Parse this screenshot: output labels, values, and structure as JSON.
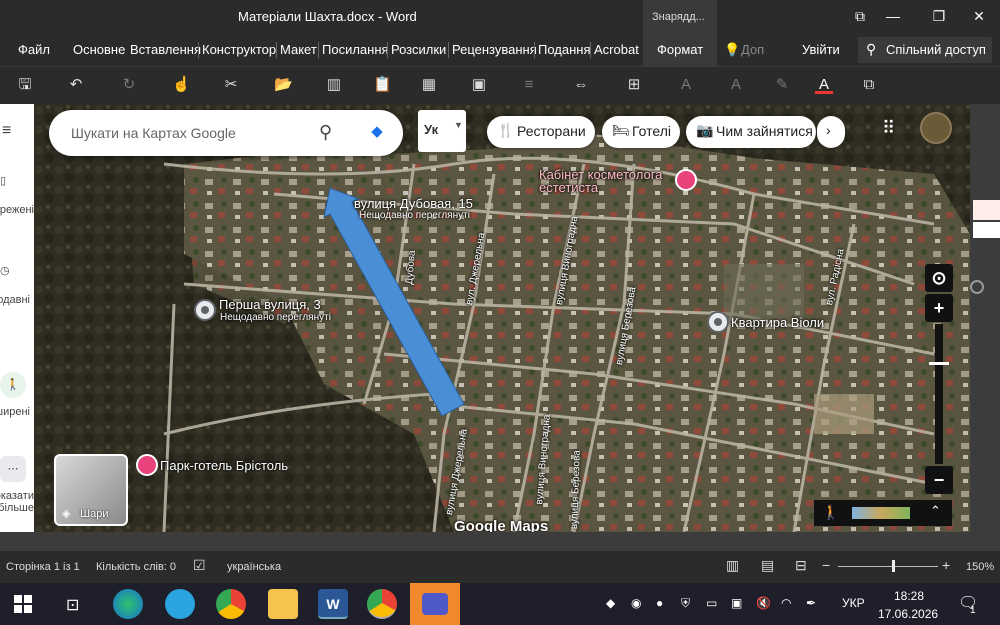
{
  "window": {
    "title": "Матеріали Шахта.docx - Word",
    "tools_tab": "Знарядд...",
    "controls": [
      "minimize",
      "restore",
      "close"
    ]
  },
  "ribbon": {
    "tabs": [
      "Файл",
      "Основне",
      "Вставлення",
      "Конструктор",
      "Макет",
      "Посилання",
      "Розсилки",
      "Рецензування",
      "Подання",
      "Acrobat",
      "Формат"
    ],
    "tell_me": "Доп",
    "sign_in": "Увійти",
    "share": "Спільний доступ"
  },
  "map": {
    "search_placeholder": "Шукати на Картах Google",
    "lang_button": "Ук",
    "pills": [
      {
        "icon": "restaurant-icon",
        "label": "Ресторани"
      },
      {
        "icon": "hotel-icon",
        "label": "Готелі"
      },
      {
        "icon": "camera-icon",
        "label": "Чим зайнятися"
      }
    ],
    "places": {
      "cosmetologist": "Кабінет косметолога естетиста",
      "dubova_street": "вулиця Дубовая, 15",
      "dubova_recent": "Нещодавно переглянуті",
      "persha_street": "Перша вулиця, 3",
      "persha_recent": "Нещодавно переглянуті",
      "apartment": "Квартира Віоли",
      "hotel": "Парк-готель Брістоль"
    },
    "streets": [
      "вул. Джерельна",
      "вулиця Виноградна",
      "вулиця Березова",
      "вул. Радісна",
      "вулиця Джерельна",
      "вулиця Виноградна",
      "вулиця Березова",
      "Дубова"
    ],
    "layers_label": "Шари",
    "brand": "Google Maps",
    "side_panel": [
      "Збережені",
      "Нещодавні",
      "Поширені",
      "Показати більше"
    ]
  },
  "status": {
    "page": "Сторінка 1 із 1",
    "words": "Кількість слів: 0",
    "language": "українська",
    "zoom": "150%"
  },
  "taskbar": {
    "lang": "УКР",
    "time": "18:28",
    "date": "17.06.2026",
    "notifications": "1"
  },
  "colors": {
    "arrow": "#4a8fd6",
    "hotel_pin": "#e8437d",
    "cosmetic_pin": "#e8437d"
  }
}
